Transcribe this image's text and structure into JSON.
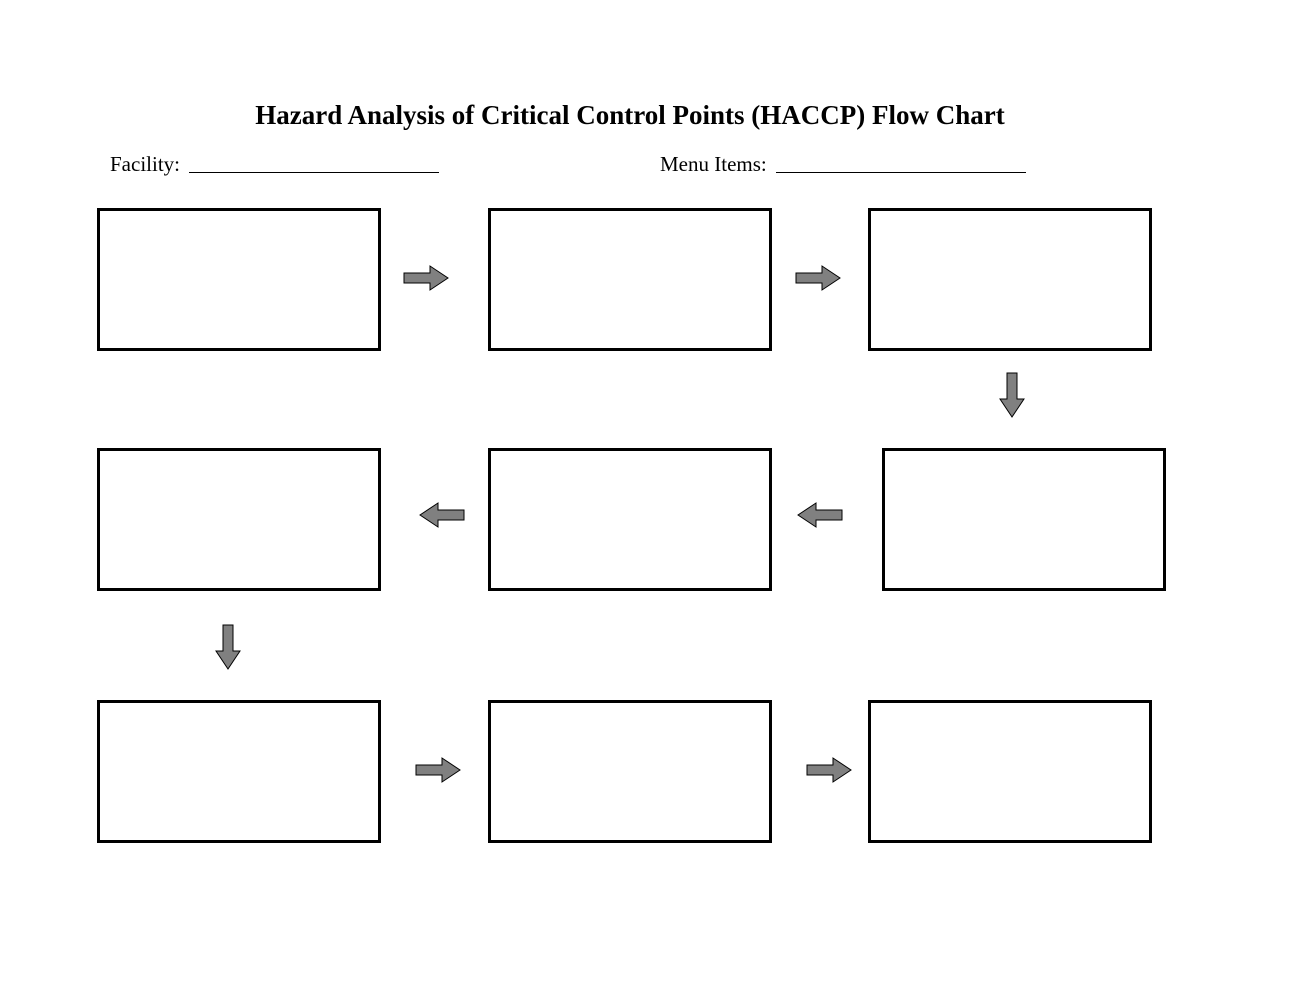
{
  "title": "Hazard Analysis of Critical Control Points (HACCP) Flow Chart",
  "fields": {
    "facility_label": "Facility:",
    "menu_items_label": "Menu Items:"
  },
  "boxes": {
    "r1c1": "",
    "r1c2": "",
    "r1c3": "",
    "r2c1": "",
    "r2c2": "",
    "r2c3": "",
    "r3c1": "",
    "r3c2": "",
    "r3c3": ""
  }
}
